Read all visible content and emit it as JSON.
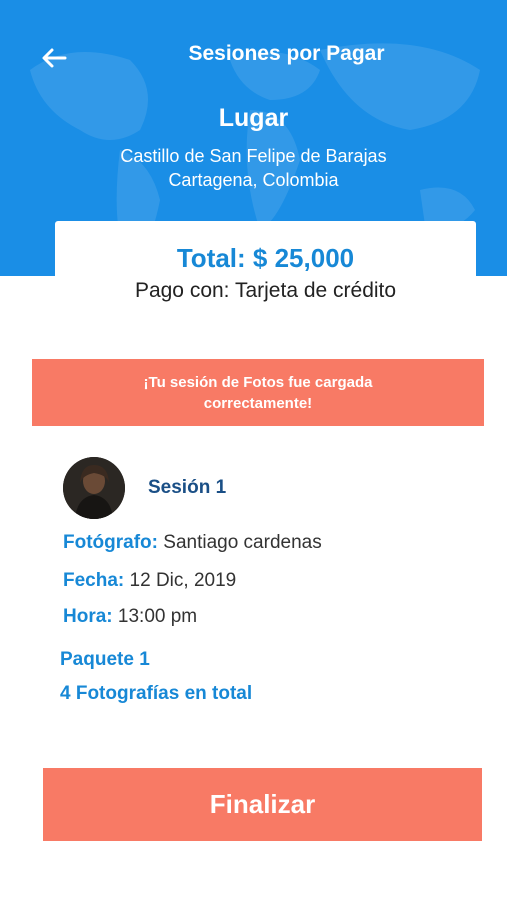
{
  "header": {
    "title": "Sesiones por Pagar",
    "back_icon": "arrow-left-icon",
    "background_color": "#1a8ee6"
  },
  "location": {
    "label": "Lugar",
    "line1": "Castillo de San Felipe de Barajas",
    "line2": "Cartagena, Colombia"
  },
  "summary": {
    "total": "Total: $ 25,000",
    "payment": "Pago con: Tarjeta de crédito"
  },
  "alert": {
    "line1": "¡Tu sesión de Fotos fue cargada",
    "line2": "correctamente!",
    "color": "#f87a65"
  },
  "session": {
    "name": "Sesión 1",
    "photographer_label": "Fotógrafo:",
    "photographer": "Santiago cardenas",
    "date_label": "Fecha:",
    "date": "12 Dic, 2019",
    "time_label": "Hora:",
    "time": "13:00 pm",
    "package": "Paquete 1",
    "photos_total": "4 Fotografías en total"
  },
  "actions": {
    "finish_label": "Finalizar"
  }
}
